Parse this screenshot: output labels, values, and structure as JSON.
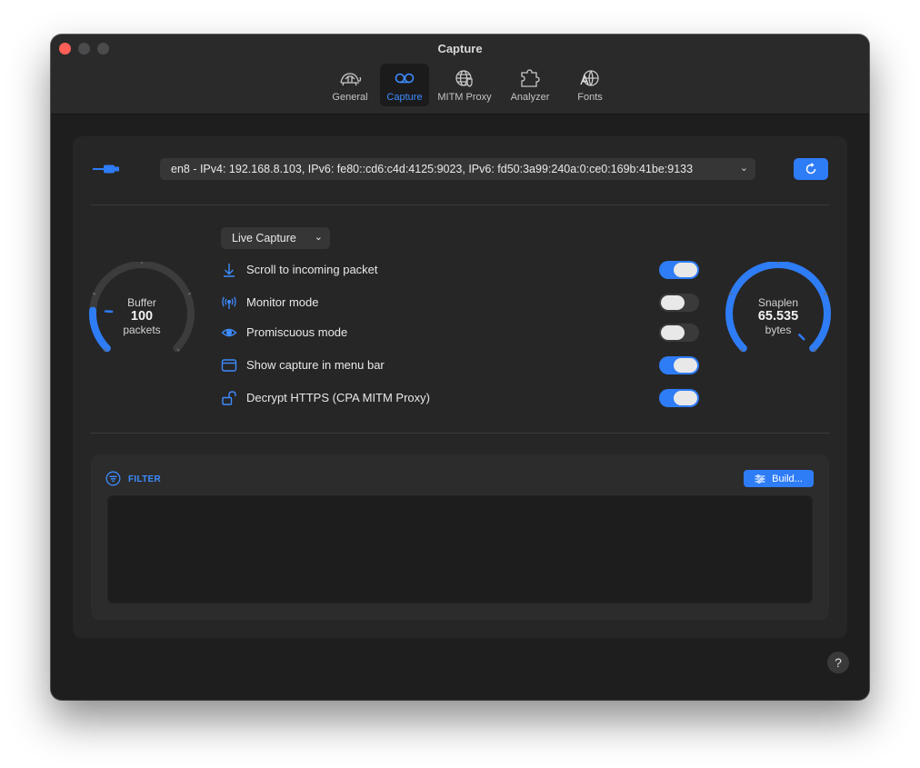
{
  "window": {
    "title": "Capture"
  },
  "toolbar": {
    "tabs": [
      {
        "label": "General",
        "icon": "turtle-icon"
      },
      {
        "label": "Capture",
        "icon": "voicemail-icon"
      },
      {
        "label": "MITM Proxy",
        "icon": "globe-shield-icon"
      },
      {
        "label": "Analyzer",
        "icon": "puzzle-icon"
      },
      {
        "label": "Fonts",
        "icon": "font-globe-icon"
      }
    ],
    "active_tab": "Capture"
  },
  "interface": {
    "selected": "en8 - IPv4: 192.168.8.103, IPv6: fe80::cd6:c4d:4125:9023, IPv6: fd50:3a99:240a:0:ce0:169b:41be:9133",
    "refresh_icon": "refresh-icon"
  },
  "capture_mode": {
    "selected": "Live Capture"
  },
  "buffer": {
    "title": "Buffer",
    "value": "100",
    "unit": "packets",
    "fraction": 0.18
  },
  "snaplen": {
    "title": "Snaplen",
    "value": "65.535",
    "unit": "bytes",
    "fraction": 1.0
  },
  "options": [
    {
      "label": "Scroll to incoming packet",
      "icon": "arrow-down-icon",
      "enabled": true
    },
    {
      "label": "Monitor mode",
      "icon": "antenna-icon",
      "enabled": false
    },
    {
      "label": "Promiscuous mode",
      "icon": "eye-icon",
      "enabled": false
    },
    {
      "label": "Show capture in menu bar",
      "icon": "window-icon",
      "enabled": true
    },
    {
      "label": "Decrypt HTTPS (CPA MITM Proxy)",
      "icon": "unlock-icon",
      "enabled": true
    }
  ],
  "filter": {
    "label": "FILTER",
    "build_label": "Build...",
    "value": ""
  },
  "help": {
    "label": "?"
  },
  "colors": {
    "accent": "#2e7cf6",
    "close": "#fe5f57",
    "background": "#1e1e1e"
  }
}
